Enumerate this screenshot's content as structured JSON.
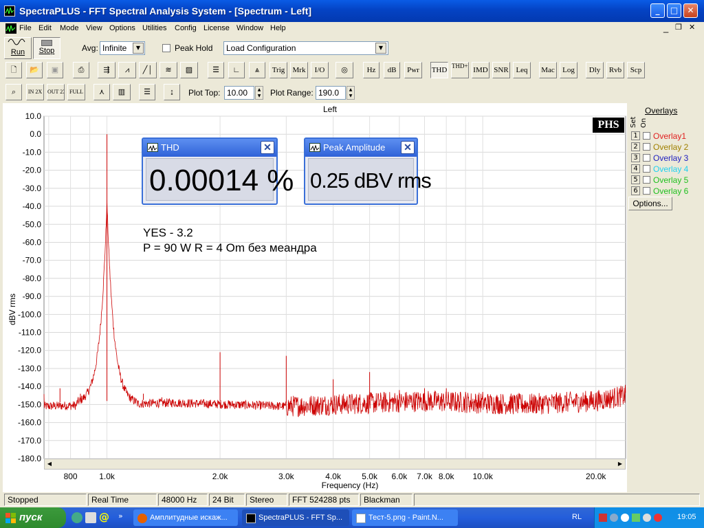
{
  "window": {
    "title": "SpectraPLUS - FFT Spectral Analysis System - [Spectrum - Left]"
  },
  "caption_buttons": {
    "minimize": "_",
    "maximize": "□",
    "close": "✕"
  },
  "menu": [
    "File",
    "Edit",
    "Mode",
    "View",
    "Options",
    "Utilities",
    "Config",
    "License",
    "Window",
    "Help"
  ],
  "toolbar1": {
    "run_label": "Run",
    "stop_label": "Stop",
    "avg_label": "Avg:",
    "avg_value": "Infinite",
    "peak_hold_label": "Peak Hold",
    "config_value": "Load Configuration"
  },
  "toolbar2": [
    "Trig",
    "Mrk",
    "I/O",
    "Hz",
    "dB",
    "Pwr",
    "THD",
    "THD+N",
    "IMD",
    "SNR",
    "Leq",
    "Mac",
    "Log",
    "Dly",
    "Rvb",
    "Scp"
  ],
  "toolbar3": {
    "plot_top_label": "Plot Top:",
    "plot_top_value": "10.00",
    "plot_range_label": "Plot Range:",
    "plot_range_value": "190.0"
  },
  "plot": {
    "title": "Left",
    "logo": "PHS"
  },
  "chart_data": {
    "type": "line",
    "title": "Left",
    "xlabel": "Frequency (Hz)",
    "ylabel": "dBV rms",
    "xscale": "log",
    "xlim": [
      680,
      24000
    ],
    "ylim": [
      -180,
      10
    ],
    "grid": true,
    "x_ticks": [
      800,
      1000,
      2000,
      3000,
      4000,
      5000,
      6000,
      7000,
      8000,
      10000,
      20000
    ],
    "x_tick_labels": [
      "800",
      "1.0k",
      "2.0k",
      "3.0k",
      "4.0k",
      "5.0k",
      "6.0k",
      "7.0k",
      "8.0k",
      "10.0k",
      "20.0k"
    ],
    "y_ticks": [
      10,
      0,
      -10,
      -20,
      -30,
      -40,
      -50,
      -60,
      -70,
      -80,
      -90,
      -100,
      -110,
      -120,
      -130,
      -140,
      -150,
      -160,
      -170,
      -180
    ],
    "y_tick_labels": [
      "10.0",
      "0.0",
      "-10.0",
      "-20.0",
      "-30.0",
      "-40.0",
      "-50.0",
      "-60.0",
      "-70.0",
      "-80.0",
      "-90.0",
      "-100.0",
      "-110.0",
      "-120.0",
      "-130.0",
      "-140.0",
      "-150.0",
      "-160.0",
      "-170.0",
      "-180.0"
    ],
    "series": [
      {
        "color": "#cc0000",
        "noise_floor": [
          [
            680,
            -151
          ],
          [
            1500,
            -149
          ],
          [
            3000,
            -151
          ],
          [
            7000,
            -148
          ],
          [
            13000,
            -150
          ],
          [
            20000,
            -148
          ],
          [
            24000,
            -145
          ]
        ],
        "peaks": [
          [
            1000,
            0
          ],
          [
            2000,
            -121
          ],
          [
            3000,
            -123
          ],
          [
            4000,
            -136
          ],
          [
            5000,
            -132
          ],
          [
            6000,
            -142
          ],
          [
            7000,
            -141
          ],
          [
            8000,
            -141
          ],
          [
            9000,
            -143
          ],
          [
            10000,
            -143
          ],
          [
            12000,
            -145
          ],
          [
            15000,
            -146
          ],
          [
            18000,
            -146
          ],
          [
            750,
            -141
          ],
          [
            850,
            -144
          ],
          [
            1250,
            -144
          ],
          [
            1400,
            -146
          ]
        ]
      }
    ]
  },
  "annotation": {
    "line1": "YES - 3.2",
    "line2": "P = 90 W  R = 4 Om  без меандра"
  },
  "meters": [
    {
      "title": "THD",
      "value": "0.00014 %"
    },
    {
      "title": "Peak Amplitude",
      "value": "0.25 dBV rms"
    }
  ],
  "overlays": {
    "title": "Overlays",
    "set_label": "Set",
    "on_label": "On",
    "items": [
      {
        "num": "1",
        "name": "Overlay1",
        "color": "#e02020"
      },
      {
        "num": "2",
        "name": "Overlay 2",
        "color": "#a08000"
      },
      {
        "num": "3",
        "name": "Overlay 3",
        "color": "#2020c0"
      },
      {
        "num": "4",
        "name": "Overlay 4",
        "color": "#20d0f0"
      },
      {
        "num": "5",
        "name": "Overlay 5",
        "color": "#20c020"
      },
      {
        "num": "6",
        "name": "Overlay 6",
        "color": "#20c020"
      }
    ],
    "options_label": "Options..."
  },
  "status": [
    "Stopped",
    "Real Time",
    "48000 Hz",
    "24 Bit",
    "Stereo",
    "FFT 524288 pts",
    "Blackman"
  ],
  "taskbar": {
    "start_label": "пуск",
    "tasks": [
      "Амплитудные искаж...",
      "SpectraPLUS - FFT Sp...",
      "Тест-5.png - Paint.N..."
    ],
    "lang": "RL",
    "clock": "19:05"
  }
}
